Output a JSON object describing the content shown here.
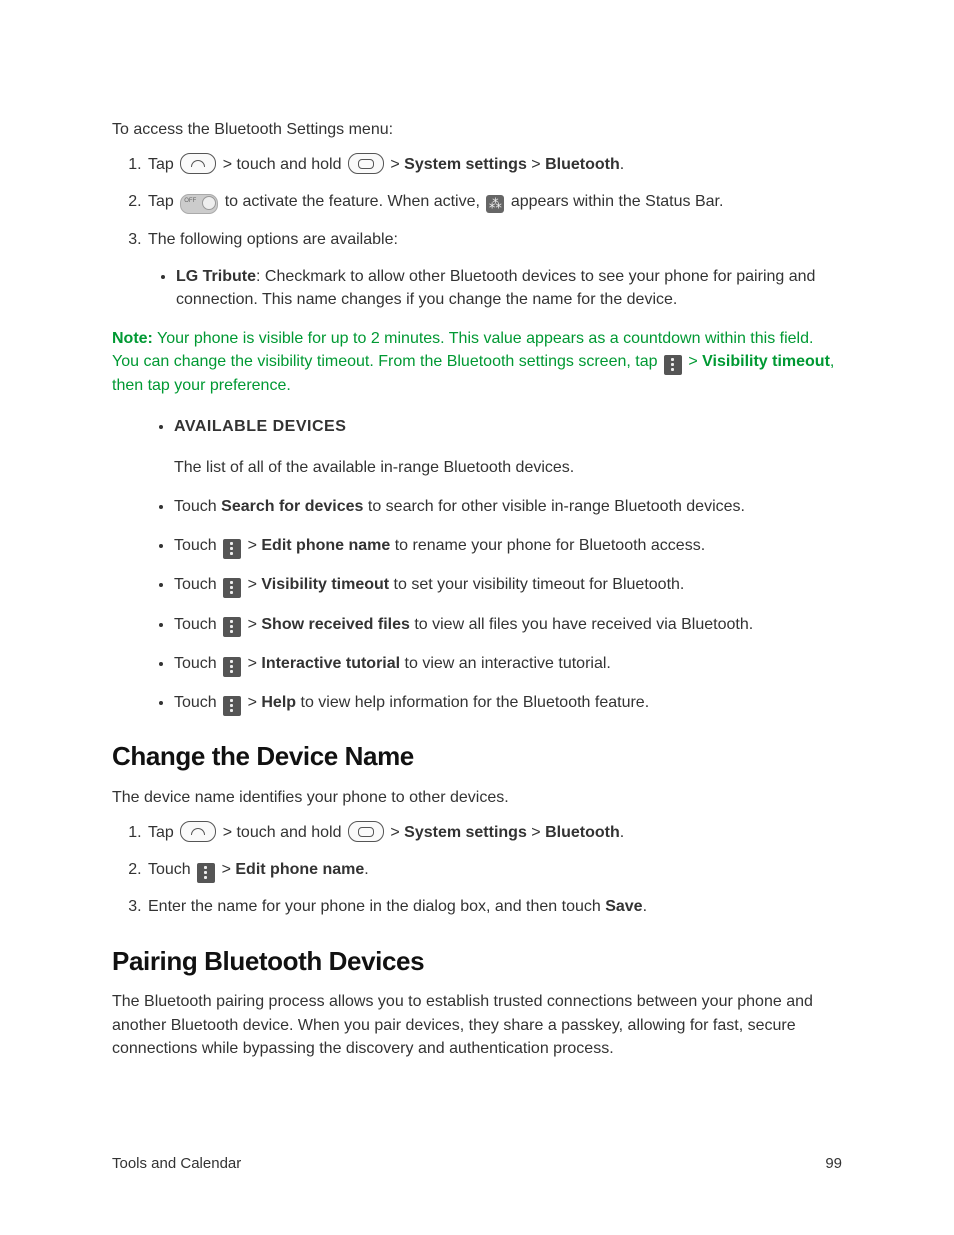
{
  "intro": "To access the Bluetooth Settings menu:",
  "steps1": {
    "s1": {
      "pre": "Tap ",
      "mid1": " > touch and hold ",
      "mid2": " > ",
      "sys": "System settings",
      "sep": " > ",
      "bt": "Bluetooth",
      "end": "."
    },
    "s2": {
      "pre": "Tap ",
      "mid": " to activate the feature. When active, ",
      "post": " appears within the Status Bar."
    },
    "s3": "The following options are available:"
  },
  "optA": {
    "label": "LG Tribute",
    "text": ": Checkmark to allow other Bluetooth devices to see your phone for pairing and connection. This name changes if you change the name for the device."
  },
  "note": {
    "label": "Note:",
    "l1": " Your phone is visible for up to 2 minutes. This value appears as a countdown within this field. You can change the visibility timeout. From the Bluetooth settings screen, tap ",
    "sep": " > ",
    "vt": "Visibility timeout",
    "l2": ", then tap your preference."
  },
  "list2": {
    "avail_title": "AVAILABLE DEVICES",
    "avail_desc": "The list of all of the available in-range Bluetooth devices.",
    "search": {
      "pre": "Touch ",
      "b": "Search for devices",
      "post": " to search for other visible in-range Bluetooth devices."
    },
    "edit": {
      "pre": "Touch ",
      "sep": " > ",
      "b": "Edit phone name",
      "post": " to rename your phone for Bluetooth access."
    },
    "vis": {
      "pre": "Touch ",
      "sep": " > ",
      "b": "Visibility timeout",
      "post": " to set your visibility timeout for Bluetooth."
    },
    "show": {
      "pre": "Touch ",
      "sep": " > ",
      "b": "Show received files",
      "post": " to view all files you have received via Bluetooth."
    },
    "tut": {
      "pre": "Touch ",
      "sep": " > ",
      "b": "Interactive tutorial",
      "post": " to view an interactive tutorial."
    },
    "help": {
      "pre": "Touch ",
      "sep": " > ",
      "b": "Help",
      "post": " to view help information for the Bluetooth feature."
    }
  },
  "h_change": "Change the Device Name",
  "change_intro": "The device name identifies your phone to other devices.",
  "steps2": {
    "s1": {
      "pre": "Tap ",
      "mid1": " > touch and hold ",
      "mid2": " > ",
      "sys": "System settings",
      "sep": " > ",
      "bt": "Bluetooth",
      "end": "."
    },
    "s2": {
      "pre": "Touch ",
      "sep": " > ",
      "b": "Edit phone name",
      "end": "."
    },
    "s3": {
      "pre": "Enter the name for your phone in the dialog box, and then touch ",
      "b": "Save",
      "end": "."
    }
  },
  "h_pair": "Pairing Bluetooth Devices",
  "pair_intro": "The Bluetooth pairing process allows you to establish trusted connections between your phone and another Bluetooth device. When you pair devices, they share a passkey, allowing for fast, secure connections while bypassing the discovery and authentication process.",
  "footer": {
    "left": "Tools and Calendar",
    "right": "99"
  }
}
